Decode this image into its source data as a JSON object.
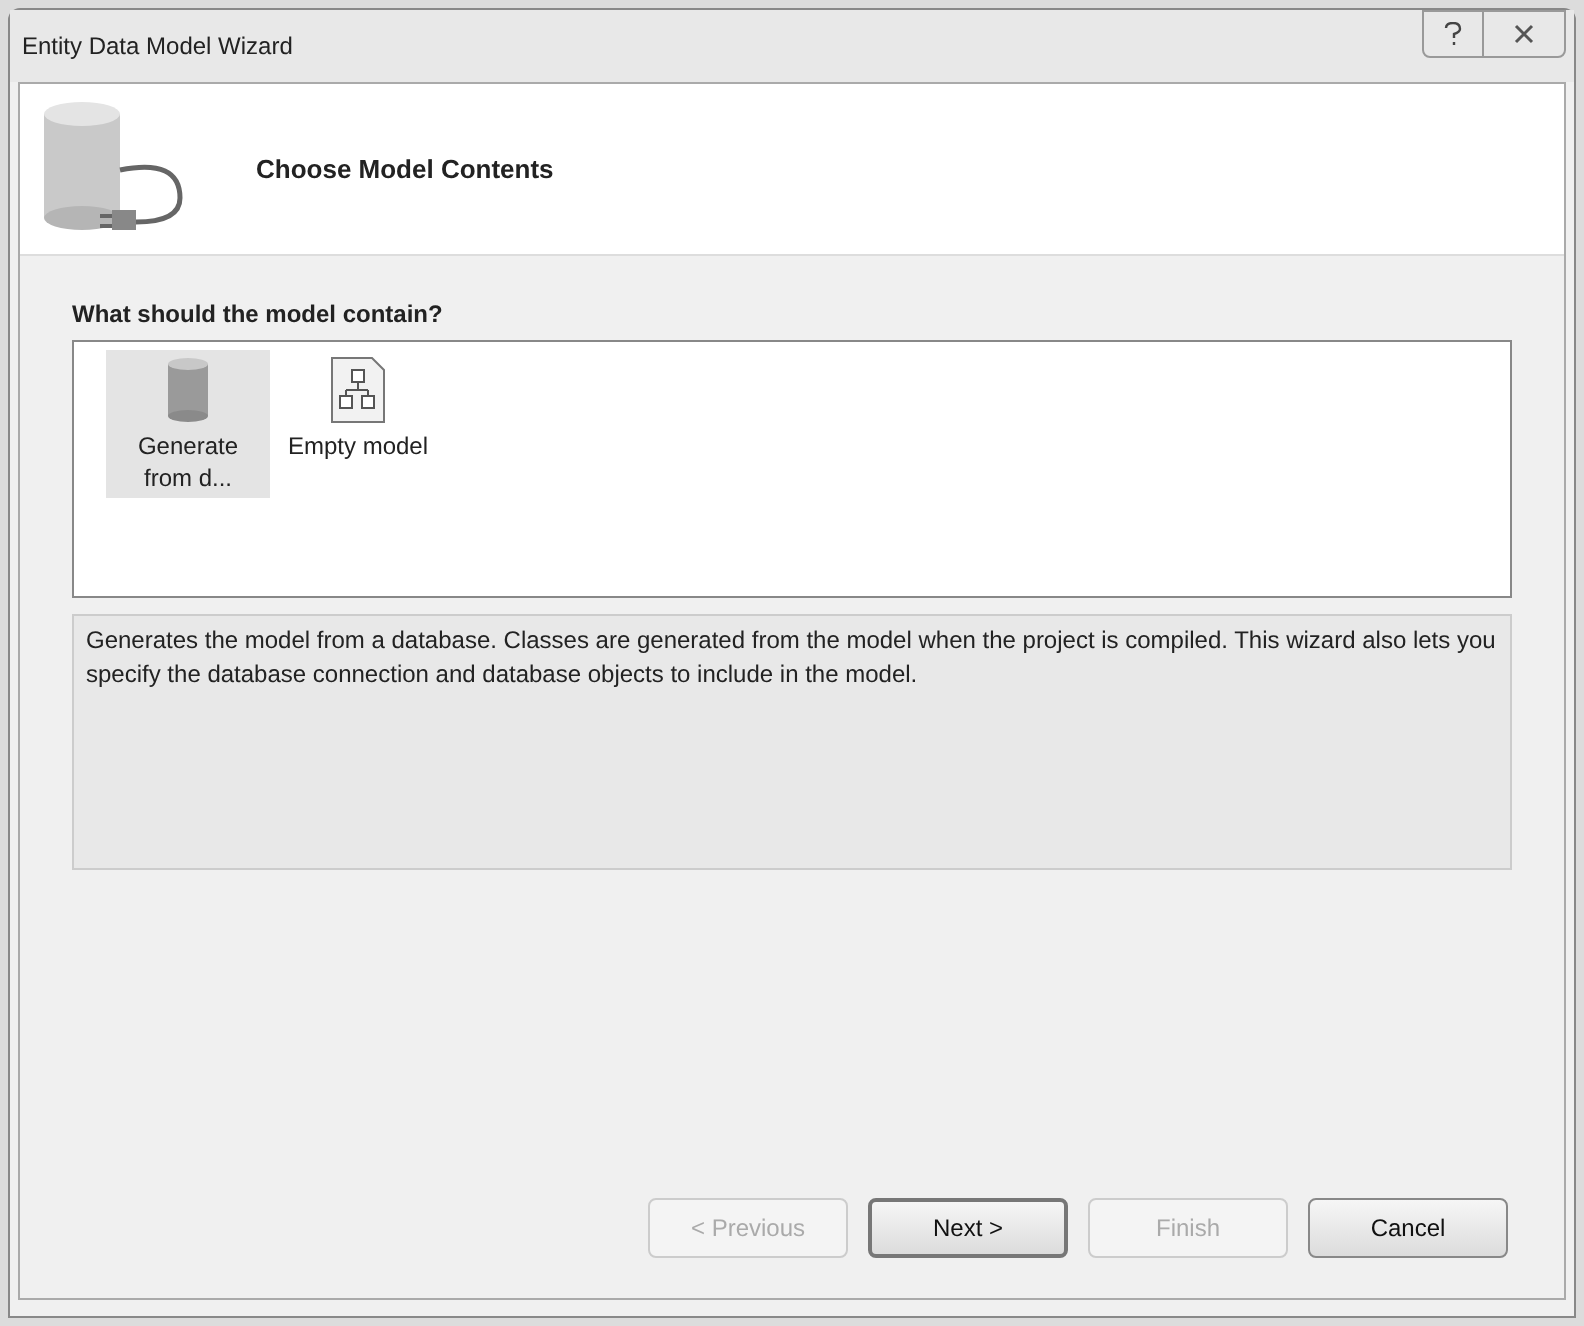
{
  "window": {
    "title": "Entity Data Model Wizard"
  },
  "header": {
    "title": "Choose Model Contents"
  },
  "question": "What should the model contain?",
  "model_options": [
    {
      "kind": "database",
      "label": "Generate from d...",
      "selected": true
    },
    {
      "kind": "diagram",
      "label": "Empty model",
      "selected": false
    }
  ],
  "description": "Generates the model from a database. Classes are generated from the model when the project is compiled. This wizard also lets you specify the database connection and database objects to include in the model.",
  "buttons": [
    {
      "label": "< Previous",
      "disabled": true,
      "default": false
    },
    {
      "label": "Next >",
      "disabled": false,
      "default": true
    },
    {
      "label": "Finish",
      "disabled": true,
      "default": false
    },
    {
      "label": "Cancel",
      "disabled": false,
      "default": false
    }
  ]
}
